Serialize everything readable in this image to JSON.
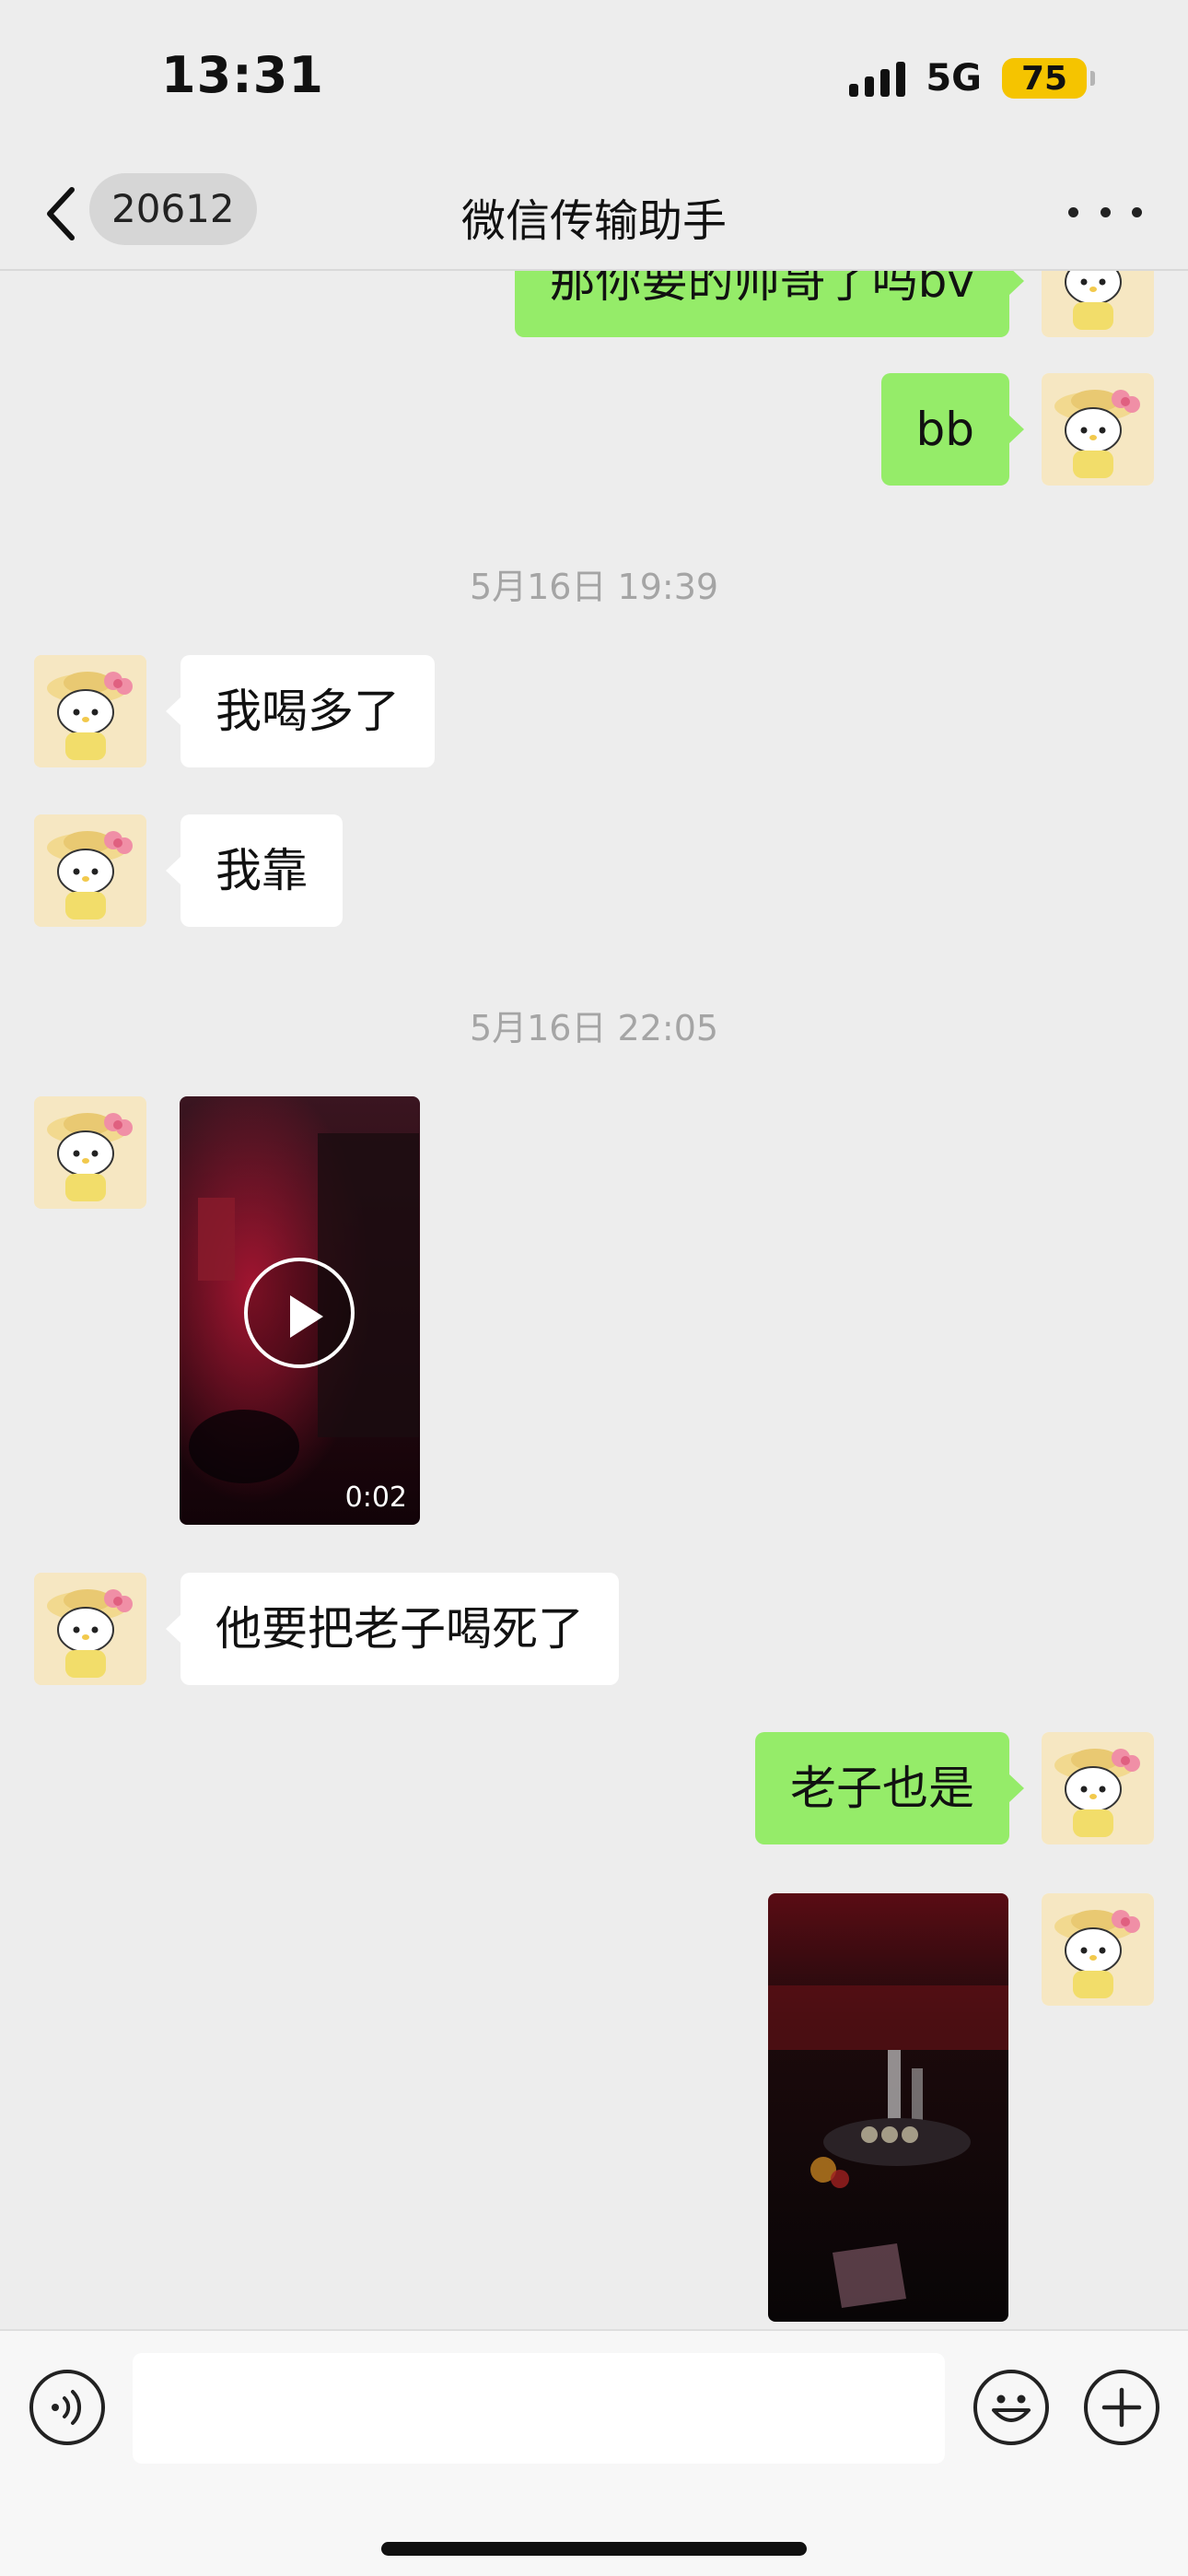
{
  "status_bar": {
    "time": "13:31",
    "network": "5G",
    "battery": "75"
  },
  "nav": {
    "unread_count": "20612",
    "title": "微信传输助手"
  },
  "messages": [
    {
      "type": "text",
      "side": "out",
      "text": "那你要的帅哥了吗bv"
    },
    {
      "type": "text",
      "side": "out",
      "text": "bb"
    },
    {
      "type": "time",
      "text": "5月16日 19:39"
    },
    {
      "type": "text",
      "side": "in",
      "text": "我喝多了"
    },
    {
      "type": "text",
      "side": "in",
      "text": "我靠"
    },
    {
      "type": "time",
      "text": "5月16日 22:05"
    },
    {
      "type": "video",
      "side": "in",
      "duration": "0:02"
    },
    {
      "type": "text",
      "side": "in",
      "text": "他要把老子喝死了"
    },
    {
      "type": "text",
      "side": "out",
      "text": "老子也是"
    },
    {
      "type": "image",
      "side": "out"
    }
  ],
  "input_bar": {
    "voice_icon": "voice-icon",
    "emoji_icon": "emoji-icon",
    "plus_icon": "plus-icon"
  },
  "colors": {
    "background": "#ededed",
    "outgoing_bubble": "#95ec69",
    "incoming_bubble": "#ffffff",
    "battery": "#f5c400"
  }
}
